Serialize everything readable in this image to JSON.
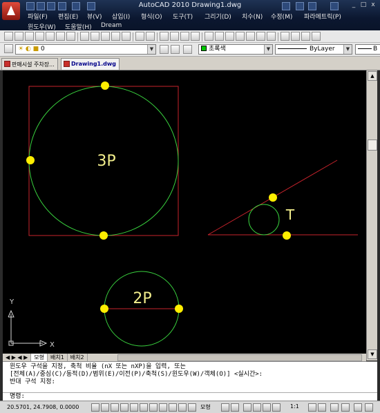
{
  "window": {
    "title": "AutoCAD 2010   Drawing1.dwg",
    "menu_row1": [
      "파일(F)",
      "편집(E)",
      "뷰(V)",
      "삽입(I)",
      "형식(O)",
      "도구(T)",
      "그리기(D)",
      "치수(N)",
      "수정(M)",
      "파라메트릭(P)"
    ],
    "menu_row2": [
      "윈도우(W)",
      "도움말(H)",
      "Dream"
    ],
    "window_buttons": [
      "_",
      "□",
      "x"
    ]
  },
  "layers_toolbar": {
    "layer_value": "0",
    "color_value": "초록색",
    "linetype_value": "ByLayer",
    "lineweight_value": "B"
  },
  "doc_tabs": [
    "판매시설 주차장...",
    "Drawing1.dwg"
  ],
  "canvas": {
    "label_3p": "3P",
    "label_t": "T",
    "label_2p": "2P",
    "ucs_x": "X",
    "ucs_y": "Y"
  },
  "layout_tabs": [
    "모형",
    "배치1",
    "배치2"
  ],
  "command_lines": [
    "윈도우 구석을 지정, 축척 비율 (nX 또는 nXP)을 입력, 또는",
    "[전체(A)/중심(C)/동적(D)/범위(E)/이전(P)/축척(S)/윈도우(W)/객체(O)] <실시간>:",
    "반대 구석 지정:"
  ],
  "command_prompt": "명령:",
  "status": {
    "coords": "20.5701, 24.7908, 0.0000",
    "model_label": "모형",
    "scale_label": "1:1"
  },
  "colors": {
    "circle": "#39d13e",
    "construction": "#c8232c",
    "grip": "#ffee00",
    "label": "#f2ee8c"
  }
}
